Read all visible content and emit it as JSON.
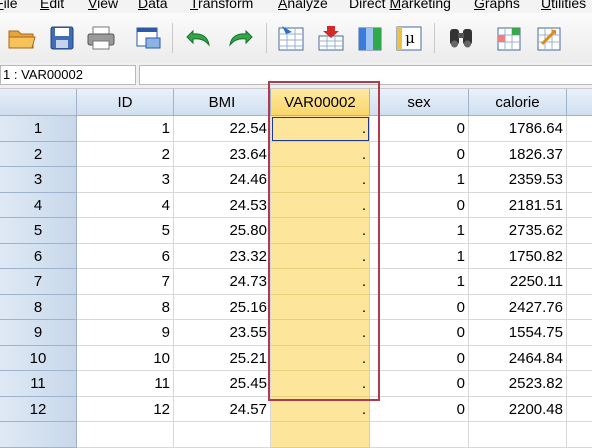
{
  "menu": {
    "items": [
      {
        "label": "File",
        "mnemonic": "F"
      },
      {
        "label": "Edit",
        "mnemonic": "E"
      },
      {
        "label": "View",
        "mnemonic": "V"
      },
      {
        "label": "Data",
        "mnemonic": "D"
      },
      {
        "label": "Transform",
        "mnemonic": "T"
      },
      {
        "label": "Analyze",
        "mnemonic": "A"
      },
      {
        "label": "Direct Marketing",
        "mnemonic": "M"
      },
      {
        "label": "Graphs",
        "mnemonic": "G"
      },
      {
        "label": "Utilities",
        "mnemonic": "U"
      }
    ]
  },
  "toolbar": {
    "icons": [
      "open-folder-icon",
      "save-icon",
      "print-icon",
      "dialog-recall-icon",
      "undo-icon",
      "redo-icon",
      "go-to-case-icon",
      "insert-cases-icon",
      "insert-variable-icon",
      "variables-icon",
      "find-icon",
      "split-file-icon",
      "weight-cases-icon"
    ]
  },
  "refbar": {
    "cell_name": "1 : VAR00002",
    "cell_value": ""
  },
  "grid": {
    "columns": [
      "ID",
      "BMI",
      "VAR00002",
      "sex",
      "calorie",
      ""
    ],
    "selected_column": "VAR00002",
    "rows": [
      {
        "row": "1",
        "ID": "1",
        "BMI": "22.54",
        "VAR00002": ".",
        "sex": "0",
        "calorie": "1786.64"
      },
      {
        "row": "2",
        "ID": "2",
        "BMI": "23.64",
        "VAR00002": ".",
        "sex": "0",
        "calorie": "1826.37"
      },
      {
        "row": "3",
        "ID": "3",
        "BMI": "24.46",
        "VAR00002": ".",
        "sex": "1",
        "calorie": "2359.53"
      },
      {
        "row": "4",
        "ID": "4",
        "BMI": "24.53",
        "VAR00002": ".",
        "sex": "0",
        "calorie": "2181.51"
      },
      {
        "row": "5",
        "ID": "5",
        "BMI": "25.80",
        "VAR00002": ".",
        "sex": "1",
        "calorie": "2735.62"
      },
      {
        "row": "6",
        "ID": "6",
        "BMI": "23.32",
        "VAR00002": ".",
        "sex": "1",
        "calorie": "1750.82"
      },
      {
        "row": "7",
        "ID": "7",
        "BMI": "24.73",
        "VAR00002": ".",
        "sex": "1",
        "calorie": "2250.11"
      },
      {
        "row": "8",
        "ID": "8",
        "BMI": "25.16",
        "VAR00002": ".",
        "sex": "0",
        "calorie": "2427.76"
      },
      {
        "row": "9",
        "ID": "9",
        "BMI": "23.55",
        "VAR00002": ".",
        "sex": "0",
        "calorie": "1554.75"
      },
      {
        "row": "10",
        "ID": "10",
        "BMI": "25.21",
        "VAR00002": ".",
        "sex": "0",
        "calorie": "2464.84"
      },
      {
        "row": "11",
        "ID": "11",
        "BMI": "25.45",
        "VAR00002": ".",
        "sex": "0",
        "calorie": "2523.82"
      },
      {
        "row": "12",
        "ID": "12",
        "BMI": "24.57",
        "VAR00002": ".",
        "sex": "0",
        "calorie": "2200.48"
      },
      {
        "row": "",
        "ID": "",
        "BMI": "",
        "VAR00002": "",
        "sex": "",
        "calorie": ""
      }
    ]
  },
  "colors": {
    "selected_column_fill": "#fde59c",
    "annotation_box": "#b23a4a",
    "header_blue": "#d0dfef"
  }
}
